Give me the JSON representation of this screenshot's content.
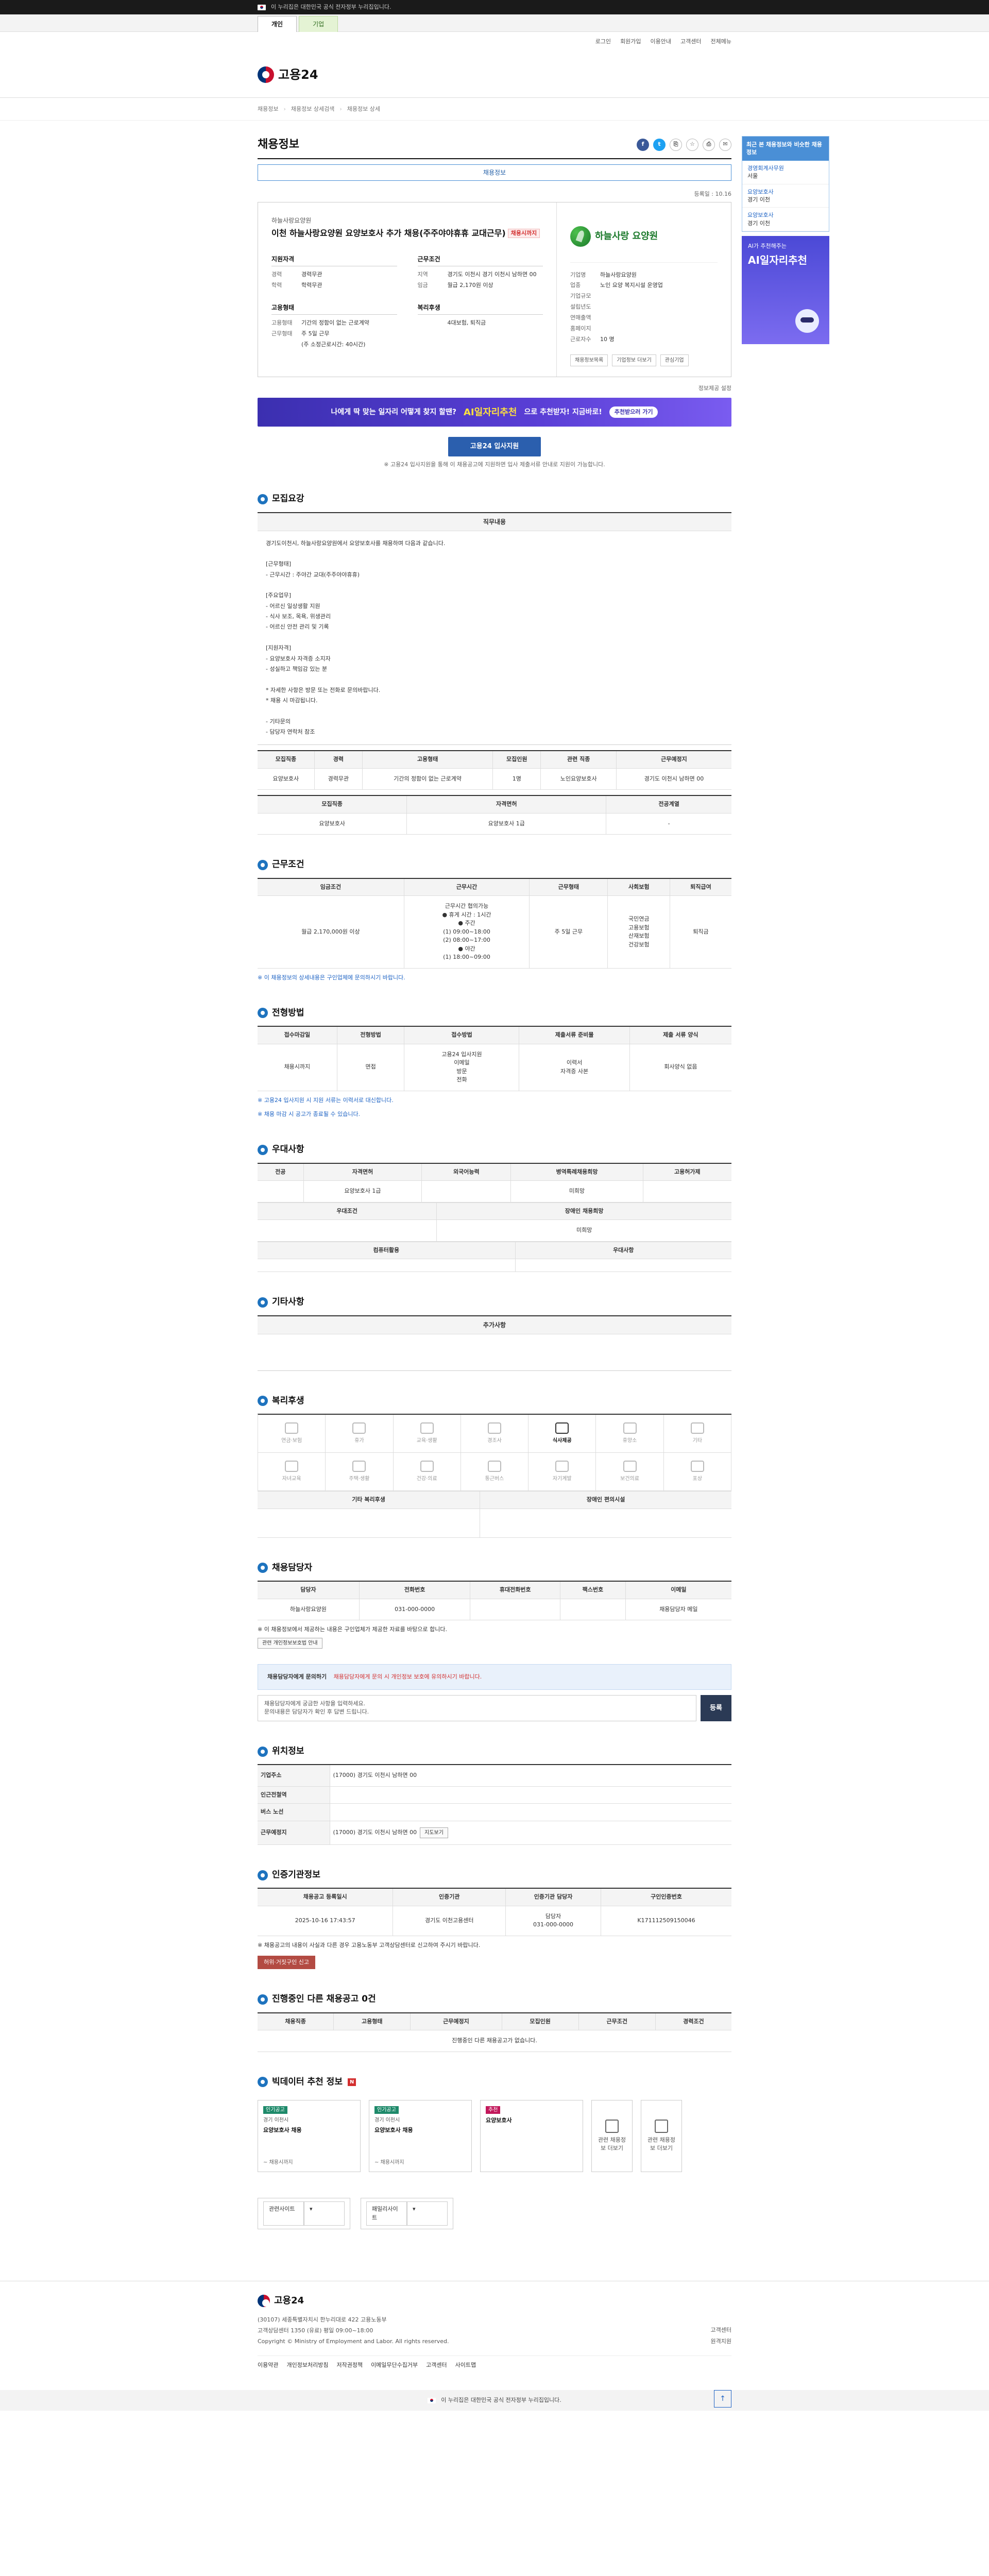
{
  "topbar": {
    "notice": "이 누리집은 대한민국 공식 전자정부 누리집입니다."
  },
  "site_tabs": [
    "개인",
    "기업"
  ],
  "util_links": [
    "로그인",
    "회원가입",
    "이용안내",
    "고객센터",
    "전체메뉴"
  ],
  "logo": {
    "text": "고용24"
  },
  "breadcrumb": [
    "채용정보",
    "채용정보 상세검색",
    "채용정보 상세"
  ],
  "page_title": "채용정보",
  "guide_text": "채용정보",
  "reg_date": "등록일 : 10.16",
  "job": {
    "company": "하늘사랑요양원",
    "title": "이천 하늘사랑요양원 요양보호사 추가 채용(주주야야휴휴 교대근무)",
    "dday": "채용시까지",
    "experience_label": "지원자격",
    "experience": [
      {
        "k": "경력",
        "v": "경력무관"
      },
      {
        "k": "학력",
        "v": "학력무관"
      }
    ],
    "conditions_label": "근무조건",
    "conditions": [
      {
        "k": "지역",
        "v": "경기도 이천시 경기 이천시 남하면 00"
      },
      {
        "k": "임금",
        "v": "월급 2,170원 이상"
      }
    ],
    "employment_label": "고용형태",
    "employment": [
      {
        "k": "고용형태",
        "v": "기간의 정함이 없는 근로계약"
      },
      {
        "k": "근무형태",
        "v": "주 5일 근무"
      },
      {
        "k": "",
        "v": "(주 소정근로시간: 40시간)"
      }
    ],
    "welfare_label": "복리후생",
    "welfare": [
      {
        "k": "",
        "v": "4대보험, 퇴직금"
      }
    ]
  },
  "corp": {
    "name": "하늘사랑 요양원",
    "rows": [
      {
        "k": "기업명",
        "v": "하늘사랑요양원"
      },
      {
        "k": "업종",
        "v": "노인 요양 복지시설 운영업"
      },
      {
        "k": "기업규모",
        "v": ""
      },
      {
        "k": "설립년도",
        "v": ""
      },
      {
        "k": "연매출액",
        "v": ""
      },
      {
        "k": "홈페이지",
        "v": ""
      },
      {
        "k": "근로자수",
        "v": "10 명"
      }
    ],
    "buttons": [
      "채용정보목록",
      "기업정보 더보기",
      "관심기업"
    ]
  },
  "info_settings": "정보제공 설정",
  "banner": {
    "left": "나에게 딱 맞는 일자리 어떻게 찾지 할땐?",
    "ai": "AI일자리추천",
    "mid": "으로 추천받자! 지금바로!",
    "btn": "추천받으러 가기"
  },
  "apply": {
    "btn": "고용24 입사지원",
    "note": "※ 고용24 입사지원을 통해 이 채용공고에 지원하면 입사 제출서류 안내로 지원이 가능합니다."
  },
  "sections": {
    "recruit": "모집요강",
    "work": "근무조건",
    "process": "전형방법",
    "pref": "우대사항",
    "etc": "기타사항",
    "welfare": "복리후생",
    "contact": "채용담당자",
    "location": "위치정보",
    "cert": "인증기관정보",
    "others": "진행중인 다른 채용공고 0건",
    "bigdata": "빅데이터 추천 정보"
  },
  "recruit": {
    "duty_head": "직무내용",
    "duty": "경기도이천시, 하늘사랑요양원에서 요양보호사를 채용하며 다음과 같습니다.\n\n[근무형태]\n- 근무시간 : 주야간 교대(주주야야휴휴)\n\n[주요업무]\n- 어르신 일상생활 지원\n- 식사 보조, 목욕, 위생관리\n- 어르신 안전 관리 및 기록\n\n[지원자격]\n- 요양보호사 자격증 소지자\n- 성실하고 책임감 있는 분\n\n* 자세한 사항은 방문 또는 전화로 문의바랍니다.\n* 채용 시 마감됩니다.\n\n- 기타문의\n- 담당자 연락처 참조",
    "t1_head": [
      "모집직종",
      "경력",
      "고용형태",
      "모집인원",
      "관련 직종",
      "근무예정지"
    ],
    "t1_row": [
      "요양보호사",
      "경력무관",
      "기간의 정함이 없는 근로계약",
      "1명",
      "노인요양보호사",
      "경기도 이천시 남하면 00"
    ],
    "t2_head": [
      "모집직종",
      "자격면허",
      "전공계열"
    ],
    "t2_row": [
      "요양보호사",
      "요양보호사 1급",
      "-"
    ]
  },
  "work": {
    "head": [
      "임금조건",
      "근무시간",
      "근무형태",
      "사회보험",
      "퇴직급여"
    ],
    "row": [
      "월급 2,170,000원 이상",
      "근무시간 협의가능\n● 휴게 시간 : 1시간\n● 주간\n(1) 09:00~18:00\n(2) 08:00~17:00\n● 야간\n(1) 18:00~09:00",
      "주 5일 근무",
      "국민연금\n고용보험\n산재보험\n건강보험",
      "퇴직금"
    ],
    "note": "※ 이 채용정보의 상세내용은 구인업체에 문의하시기 바랍니다."
  },
  "process": {
    "head": [
      "접수마감일",
      "전형방법",
      "접수방법",
      "제출서류 준비물",
      "제출 서류 양식"
    ],
    "row": [
      "채용시까지",
      "면접",
      "고용24 입사지원\n이메일\n방문\n전화",
      "이력서\n자격증 사본",
      "회사양식 없음"
    ],
    "notes": [
      "※ 고용24 입사지원 시 지원 서류는 이력서로 대신합니다.",
      "※ 채용 마감 시 공고가 종료될 수 있습니다."
    ]
  },
  "pref": {
    "head": [
      "전공",
      "자격면허",
      "외국어능력",
      "병역특례채용희망",
      "고용허가제"
    ],
    "row": [
      "",
      "요양보호사 1급",
      "",
      "미희망",
      ""
    ],
    "head2": [
      "우대조건",
      "장애인 채용희망"
    ],
    "row2": [
      "",
      "미희망"
    ],
    "head3": [
      "컴퓨터활용",
      "우대사항"
    ],
    "row3": [
      "",
      ""
    ]
  },
  "etc": {
    "head": "추가사항",
    "body": ""
  },
  "welfare": {
    "items": [
      {
        "t": "연금·보험",
        "on": false
      },
      {
        "t": "휴가",
        "on": false
      },
      {
        "t": "교육·생활",
        "on": false
      },
      {
        "t": "경조사",
        "on": false
      },
      {
        "t": "식사제공",
        "on": true
      },
      {
        "t": "휴양소",
        "on": false
      },
      {
        "t": "기타",
        "on": false
      },
      {
        "t": "자녀교육",
        "on": false
      },
      {
        "t": "주택·생활",
        "on": false
      },
      {
        "t": "건강·의료",
        "on": false
      },
      {
        "t": "통근버스",
        "on": false
      },
      {
        "t": "자기계발",
        "on": false
      },
      {
        "t": "보건의료",
        "on": false
      },
      {
        "t": "포상",
        "on": false
      }
    ],
    "head": [
      "기타 복리후생",
      "장애인 편의시설"
    ]
  },
  "contact": {
    "head": [
      "담당자",
      "전화번호",
      "휴대전화번호",
      "팩스번호",
      "이메일"
    ],
    "row": [
      "하늘사랑요양원",
      "031-000-0000",
      "",
      "",
      "채용담당자 메일"
    ],
    "note": "※ 이 채용정보에서 제공하는 내용은 구인업체가 제공한 자료를 바탕으로 합니다.",
    "btn": "관련 개인정보보호법 안내",
    "report_title": "채용담당자에게 문의하기",
    "report_note": "채용담당자에게 문의 시 개인정보 보호에 유의하시기 바랍니다.",
    "search_text": "채용담당자에게 궁금한 사항을 입력하세요.\n문의내용은 담당자가 확인 후 답변 드립니다.",
    "search_btn": "등록"
  },
  "location": {
    "rows": [
      {
        "k": "기업주소",
        "v": "(17000) 경기도 이천시 남하면 00"
      },
      {
        "k": "인근전철역",
        "v": ""
      },
      {
        "k": "버스 노선",
        "v": ""
      },
      {
        "k": "근무예정지",
        "v": "(17000) 경기도 이천시 남하면 00"
      }
    ],
    "map_btn": "지도보기"
  },
  "cert": {
    "head": [
      "채용공고 등록일시",
      "인증기관",
      "인증기관 담당자",
      "구인인증번호"
    ],
    "row": [
      "2025-10-16 17:43:57",
      "경기도 이천고용센터",
      "담당자\n031-000-0000",
      "K171112509150046"
    ],
    "note": "※ 채용공고의 내용이 사실과 다른 경우 고용노동부 고객상담센터로 신고하여 주시기 바랍니다.",
    "btn": "허위·거짓구인 신고"
  },
  "others": {
    "head": [
      "채용직종",
      "고용형태",
      "근무예정지",
      "모집인원",
      "근무조건",
      "경력조건"
    ],
    "empty": "진행중인 다른 채용공고가 없습니다."
  },
  "bigdata": {
    "cards": [
      {
        "badge": "인기공고",
        "company": "경기 이천시",
        "title": "요양보호사 채용",
        "meta": "~ 채용시까지"
      },
      {
        "badge": "인기공고",
        "company": "경기 이천시",
        "title": "요양보호사 채용",
        "meta": "~ 채용시까지"
      },
      {
        "badge": "추천",
        "company": "",
        "title": "요양보호사",
        "meta": ""
      }
    ],
    "more": [
      "관련 채용정보 더보기",
      "관련 채용정보 더보기"
    ]
  },
  "side": {
    "head": "최근 본 채용정보와 비슷한 채용정보",
    "items": [
      {
        "t": "경영회계사무원",
        "c": "서울"
      },
      {
        "t": "요양보호사",
        "c": "경기 이천"
      },
      {
        "t": "요양보호사",
        "c": "경기 이천"
      }
    ],
    "ai_small": "AI가 추천해주는",
    "ai_big": "AI일자리추천"
  },
  "selects": [
    "관련사이트",
    "패밀리사이트"
  ],
  "footer": {
    "logo": "고용24",
    "addr": "(30107) 세종특별자치시 한누리대로 422 고용노동부\n고객상담센터 1350 (유료) 평일 09:00~18:00\nCopyright © Ministry of Employment and Labor. All rights reserved.",
    "links": [
      "이용약관",
      "개인정보처리방침",
      "저작권정책",
      "이메일무단수집거부",
      "고객센터",
      "사이트맵"
    ],
    "right": [
      "고객센터",
      "원격지원"
    ]
  },
  "bottom_notice": "이 누리집은 대한민국 공식 전자정부 누리집입니다."
}
